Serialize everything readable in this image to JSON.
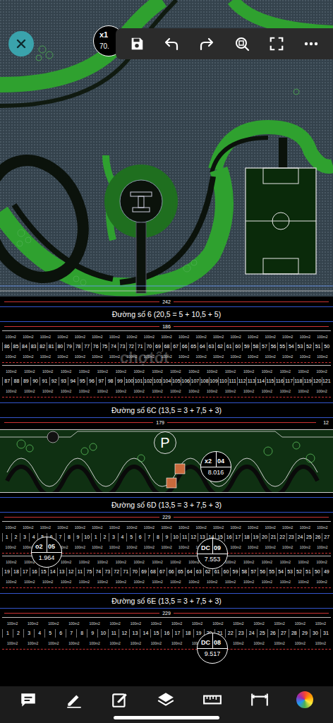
{
  "toolbar": {
    "layer_badge": {
      "code": "x1",
      "value": "70."
    }
  },
  "park": {
    "dimension": "242"
  },
  "sections": [
    {
      "kind": "road",
      "label": "Đường số 6 (20,5 = 5 + 10,5 + 5)"
    },
    {
      "kind": "lots",
      "dimension": "186",
      "area": "100m2",
      "watermark": "chợtốt",
      "badges": [],
      "rows": [
        [
          "86",
          "85",
          "84",
          "83",
          "82",
          "81",
          "80",
          "79",
          "78",
          "77",
          "76",
          "75",
          "74",
          "73",
          "72",
          "71",
          "70",
          "69",
          "68",
          "67",
          "66",
          "65",
          "64",
          "63",
          "62",
          "61",
          "60",
          "59",
          "58",
          "57",
          "56",
          "55",
          "54",
          "53",
          "52",
          "51",
          "50"
        ],
        [
          "87",
          "88",
          "89",
          "90",
          "91",
          "92",
          "93",
          "94",
          "95",
          "96",
          "97",
          "98",
          "99",
          "100",
          "101",
          "102",
          "103",
          "104",
          "105",
          "106",
          "107",
          "108",
          "109",
          "110",
          "111",
          "112",
          "113",
          "114",
          "115",
          "116",
          "117",
          "118",
          "119",
          "120",
          "121"
        ]
      ]
    },
    {
      "kind": "road",
      "label": "Đường số 6C (13,5 = 3 + 7,5 + 3)"
    },
    {
      "kind": "green",
      "dimension": "179",
      "side": "12",
      "parking": "P",
      "badges": [
        {
          "code": "x2",
          "num": "04",
          "value": "8.016"
        }
      ]
    },
    {
      "kind": "road",
      "label": "Đường số 6D (13,5 = 3 + 7,5 + 3)"
    },
    {
      "kind": "lots",
      "dimension": "229",
      "area": "100m2",
      "watermark": "",
      "badges": [
        {
          "code": "o2",
          "num": "05",
          "value": "1.964"
        },
        {
          "code": "DC",
          "num": "09",
          "value": "7.553"
        }
      ],
      "rows": [
        [
          "1",
          "2",
          "3",
          "4",
          "5",
          "6",
          "7",
          "8",
          "9",
          "10",
          "1",
          "2",
          "3",
          "4",
          "5",
          "6",
          "7",
          "8",
          "9",
          "10",
          "11",
          "12",
          "13",
          "14",
          "15",
          "16",
          "17",
          "18",
          "19",
          "20",
          "21",
          "22",
          "23",
          "24",
          "25",
          "26",
          "27"
        ],
        [
          "19",
          "18",
          "17",
          "16",
          "15",
          "14",
          "13",
          "12",
          "11",
          "75",
          "74",
          "73",
          "72",
          "71",
          "70",
          "69",
          "68",
          "67",
          "66",
          "65",
          "64",
          "63",
          "62",
          "61",
          "60",
          "59",
          "58",
          "57",
          "56",
          "55",
          "54",
          "53",
          "52",
          "51",
          "50",
          "49"
        ]
      ]
    },
    {
      "kind": "road",
      "label": "Đường số 6E (13,5 = 3 + 7,5 + 3)"
    },
    {
      "kind": "lots",
      "dimension": "229",
      "area": "100m2",
      "watermark": "",
      "badges": [
        {
          "code": "DC",
          "num": "08",
          "value": "9.517"
        }
      ],
      "rows": [
        [
          "1",
          "2",
          "3",
          "4",
          "5",
          "6",
          "7",
          "8",
          "9",
          "10",
          "11",
          "12",
          "13",
          "14",
          "15",
          "16",
          "17",
          "18",
          "19",
          "20",
          "21",
          "22",
          "23",
          "24",
          "25",
          "26",
          "27",
          "28",
          "29",
          "30",
          "31"
        ]
      ]
    }
  ]
}
